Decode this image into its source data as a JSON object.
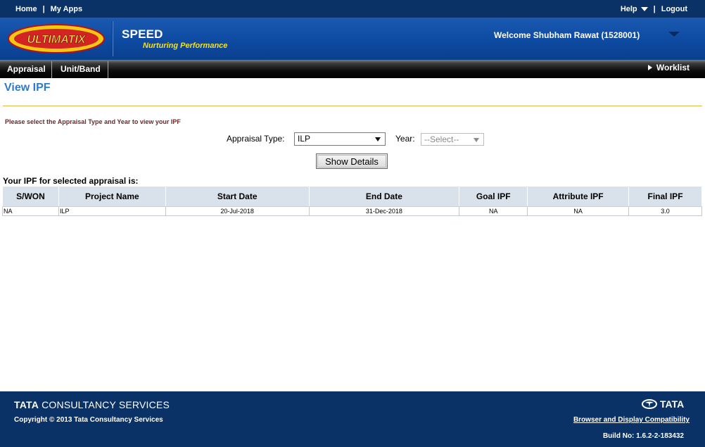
{
  "topbar": {
    "home": "Home",
    "separator": "|",
    "my_apps": "My Apps",
    "help": "Help",
    "logout": "Logout"
  },
  "header": {
    "logo_text": "ULTIMATIX",
    "app_name": "SPEED",
    "tagline": "Nurturing Performance",
    "welcome": "Welcome Shubham Rawat (1528001)"
  },
  "menu": {
    "items": [
      "Appraisal",
      "Unit/Band"
    ],
    "worklist": "Worklist"
  },
  "page": {
    "title": "View IPF",
    "instruction": "Please select the Appraisal Type and Year to view your IPF",
    "appraisal_type_label": "Appraisal Type:",
    "appraisal_type_value": "ILP",
    "year_label": "Year:",
    "year_value": "--Select--",
    "show_button": "Show Details",
    "results_caption": "Your IPF for selected appraisal is:"
  },
  "table": {
    "headers": [
      "S/WON",
      "Project Name",
      "Start Date",
      "End Date",
      "Goal IPF",
      "Attribute IPF",
      "Final IPF"
    ],
    "rows": [
      [
        "NA",
        "ILP",
        "20-Jul-2018",
        "31-Dec-2018",
        "NA",
        "NA",
        "3.0"
      ]
    ]
  },
  "footer": {
    "tcs_bold": "TATA",
    "tcs_rest": " CONSULTANCY SERVICES",
    "copyright": "Copyright © 2013 Tata Consultancy Services",
    "tata": "TATA",
    "compat_link": "Browser and Display Compatibility",
    "build": "Build No: 1.6.2-2-183432"
  },
  "colors": {
    "topbar": "#0a3267",
    "header": "#0d4aa1",
    "title": "#2f7bc9",
    "rule": "#e0b84a",
    "table_header": "#d9e2ea",
    "tagline": "#f5e11d"
  }
}
